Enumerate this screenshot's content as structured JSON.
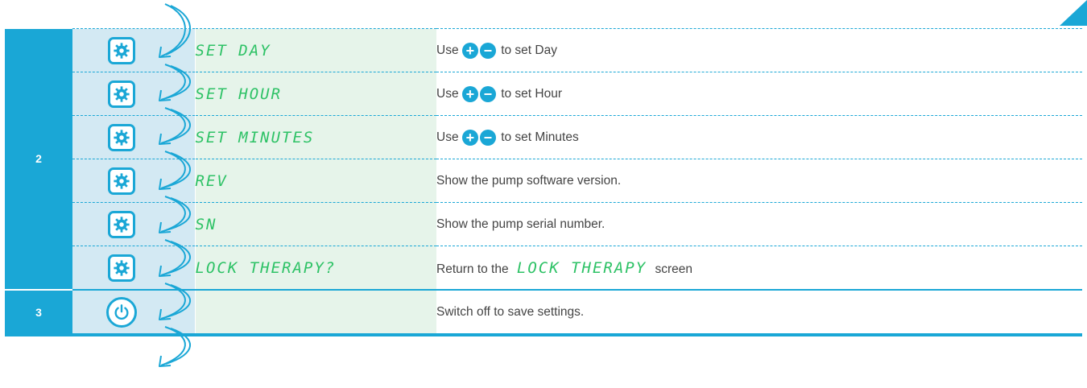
{
  "rows": [
    {
      "display": "SET DAY",
      "desc_pre": "Use",
      "desc_post": "to set Day"
    },
    {
      "display": "SET HOUR",
      "desc_pre": "Use",
      "desc_post": "to set Hour"
    },
    {
      "display": "SET MINUTES",
      "desc_pre": "Use",
      "desc_post": "to set Minutes"
    },
    {
      "display": "REV",
      "desc": "Show the pump software version."
    },
    {
      "display": "SN",
      "desc": "Show the pump serial number."
    },
    {
      "display": "LOCK THERAPY?",
      "desc_pre": "Return to the",
      "desc_inline": "LOCK THERAPY",
      "desc_post": "screen"
    },
    {
      "display": "",
      "desc": "Switch off to save settings."
    }
  ],
  "steps": {
    "step2": "2",
    "step3": "3"
  },
  "icons": {
    "settings": "gear-icon",
    "power": "power-icon",
    "plus": "plus-icon",
    "minus": "minus-icon",
    "arrow": "curved-arrow-icon"
  },
  "symbols": {
    "plus": "+",
    "minus": "−"
  },
  "colors": {
    "accent": "#1aa7d6",
    "display_text": "#2ec266",
    "display_bg": "#e6f4ea",
    "icon_col_bg": "#d3e9f3"
  }
}
